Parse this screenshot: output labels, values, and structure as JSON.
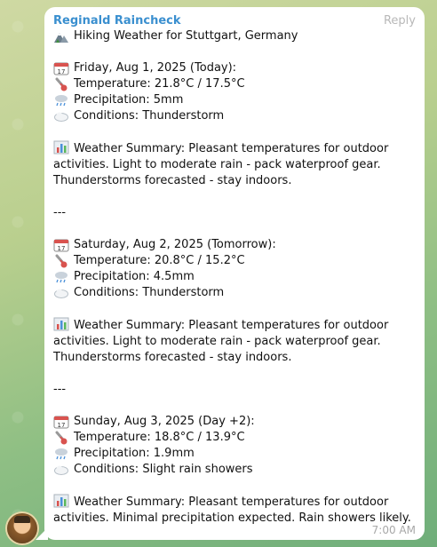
{
  "message": {
    "sender": "Reginald Raincheck",
    "reply_label": "Reply",
    "time": "7:00 AM",
    "title": "Hiking Weather for Stuttgart, Germany",
    "days": [
      {
        "date": "Friday, Aug 1, 2025 (Today):",
        "temperature": "Temperature: 21.8°C / 17.5°C",
        "precipitation": "Precipitation: 5mm",
        "conditions": "Conditions: Thunderstorm",
        "summary": "Weather Summary: Pleasant temperatures for outdoor activities. Light to moderate rain - pack waterproof gear. Thunderstorms forecasted - stay indoors.",
        "separator": "---"
      },
      {
        "date": "Saturday, Aug 2, 2025 (Tomorrow):",
        "temperature": "Temperature: 20.8°C / 15.2°C",
        "precipitation": "Precipitation: 4.5mm",
        "conditions": "Conditions: Thunderstorm",
        "summary": "Weather Summary: Pleasant temperatures for outdoor activities. Light to moderate rain - pack waterproof gear. Thunderstorms forecasted - stay indoors.",
        "separator": "---"
      },
      {
        "date": "Sunday, Aug 3, 2025 (Day +2):",
        "temperature": "Temperature: 18.8°C / 13.9°C",
        "precipitation": "Precipitation: 1.9mm",
        "conditions": "Conditions: Slight rain showers",
        "summary": "Weather Summary: Pleasant temperatures for outdoor activities. Minimal precipitation expected. Rain showers likely."
      }
    ]
  },
  "icons": {
    "title": "mountain-icon",
    "date": "calendar-icon",
    "temperature": "thermometer-icon",
    "precipitation": "rain-cloud-icon",
    "conditions": "cloud-icon",
    "summary": "bar-chart-icon"
  },
  "colors": {
    "sender": "#3a8fcf",
    "bubble": "#ffffff",
    "meta": "#a8a8a8"
  }
}
